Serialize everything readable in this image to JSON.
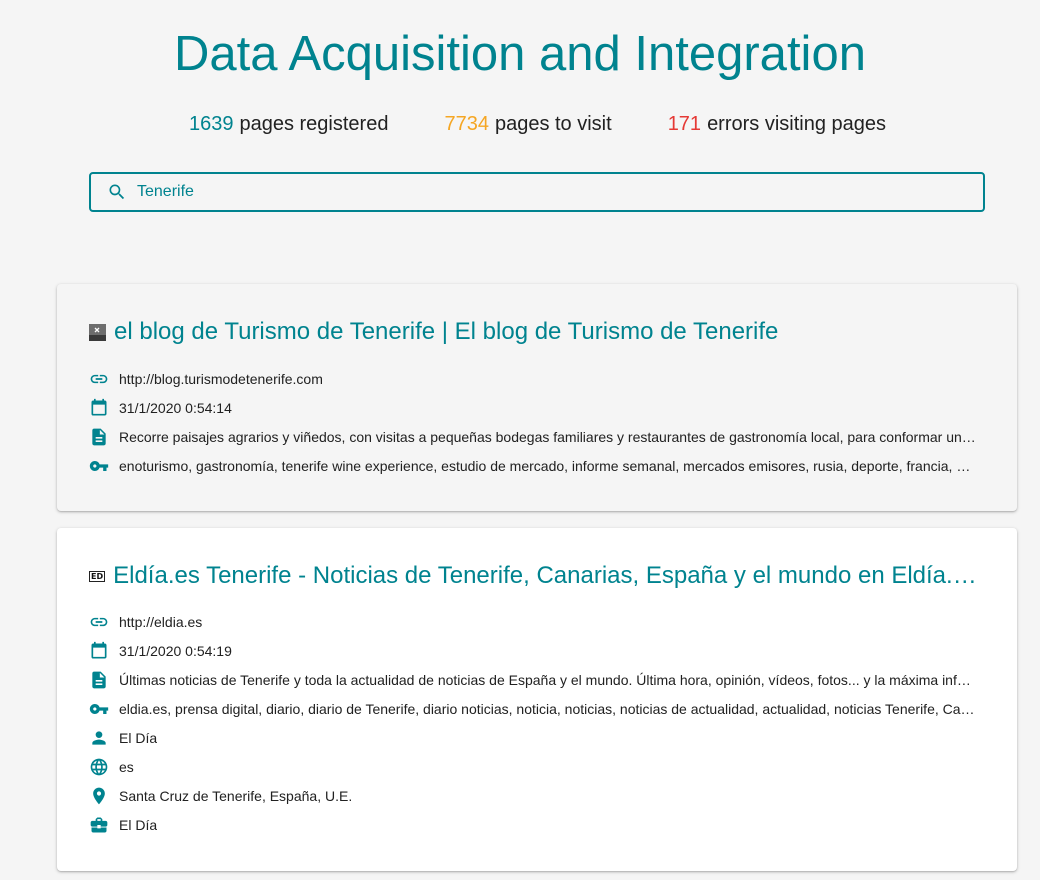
{
  "header": {
    "title": "Data Acquisition and Integration"
  },
  "stats": {
    "registered": {
      "count": "1639",
      "label": "pages registered",
      "color": "#00838f"
    },
    "to_visit": {
      "count": "7734",
      "label": "pages to visit",
      "color": "#f5a623"
    },
    "errors": {
      "count": "171",
      "label": "errors visiting pages",
      "color": "#e53935"
    }
  },
  "search": {
    "value": "Tenerife",
    "icon": "search-icon"
  },
  "results": [
    {
      "title": "el blog de Turismo de Tenerife | El blog de Turismo de Tenerife",
      "url": "http://blog.turismodetenerife.com",
      "date": "31/1/2020 0:54:14",
      "description": "Recorre paisajes agrarios y viñedos, con visitas a pequeñas bodegas familiares y restaurantes de gastronomía local, para conformar una experiencia enoturística",
      "keywords": "enoturismo, gastronomía, tenerife wine experience, estudio de mercado, informe semanal, mercados emisores, rusia, deporte, francia, alemania"
    },
    {
      "favicon_text": "ED",
      "title": "Eldía.es Tenerife - Noticias de Tenerife, Canarias, España y el mundo en Eldía.es",
      "url": "http://eldia.es",
      "date": "31/1/2020 0:54:19",
      "description": "Últimas noticias de Tenerife y toda la actualidad de noticias de España y el mundo. Última hora, opinión, vídeos, fotos... y la máxima información",
      "keywords": "eldia.es, prensa digital, diario, diario de Tenerife, diario noticias, noticia, noticias, noticias de actualidad, actualidad, noticias Tenerife, Canarias",
      "author": "El Día",
      "language": "es",
      "location": "Santa Cruz de Tenerife, España, U.E.",
      "organization": "El Día"
    }
  ],
  "icons": {
    "url": "link-icon",
    "date": "calendar-icon",
    "description": "document-icon",
    "keywords": "key-icon",
    "author": "person-icon",
    "language": "globe-icon",
    "location": "location-pin-icon",
    "organization": "briefcase-icon"
  }
}
